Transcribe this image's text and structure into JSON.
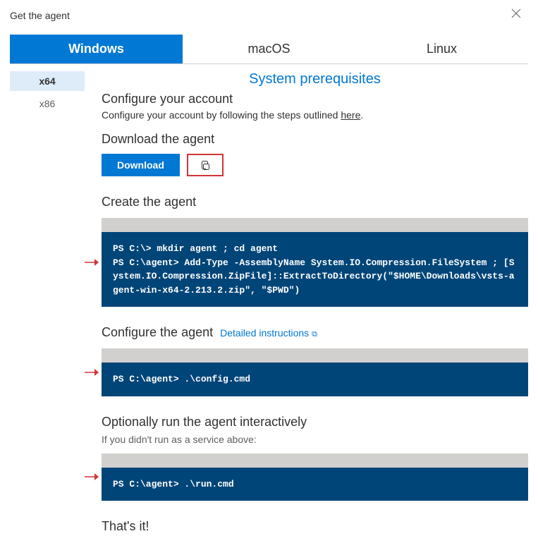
{
  "dialog": {
    "title": "Get the agent"
  },
  "tabs": {
    "windows": "Windows",
    "macos": "macOS",
    "linux": "Linux"
  },
  "arch": {
    "x64": "x64",
    "x86": "x86"
  },
  "prereq_link": "System prerequisites",
  "configure_account": {
    "heading": "Configure your account",
    "desc_prefix": "Configure your account by following the steps outlined ",
    "desc_link": "here",
    "desc_suffix": "."
  },
  "download": {
    "heading": "Download the agent",
    "button": "Download"
  },
  "create": {
    "heading": "Create the agent",
    "code": "PS C:\\> mkdir agent ; cd agent\nPS C:\\agent> Add-Type -AssemblyName System.IO.Compression.FileSystem ; [System.IO.Compression.ZipFile]::ExtractToDirectory(\"$HOME\\Downloads\\vsts-agent-win-x64-2.213.2.zip\", \"$PWD\")"
  },
  "configure_agent": {
    "heading": "Configure the agent",
    "detailed_link": "Detailed instructions",
    "code": "PS C:\\agent> .\\config.cmd"
  },
  "run": {
    "heading": "Optionally run the agent interactively",
    "note": "If you didn't run as a service above:",
    "code": "PS C:\\agent> .\\run.cmd"
  },
  "done": {
    "heading": "That's it!"
  }
}
